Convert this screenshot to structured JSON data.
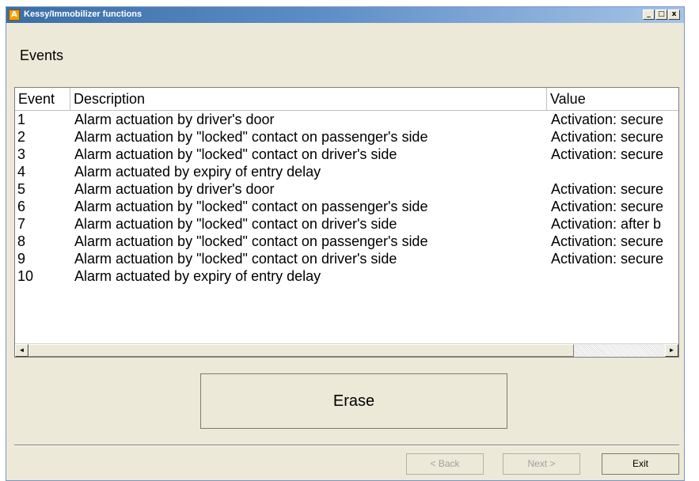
{
  "window": {
    "title": "Kessy/Immobilizer functions",
    "app_icon_letter": "A",
    "title_gradient": [
      "#3a6ea5",
      "#a6c4e6"
    ],
    "controls": {
      "minimize": "_",
      "maximize": "□",
      "close": "x"
    }
  },
  "page": {
    "heading": "Events"
  },
  "events_list": {
    "columns": [
      "Event",
      "Description",
      "Value"
    ],
    "rows": [
      {
        "event": "1",
        "description": "Alarm actuation by driver's door",
        "value": "Activation: secure"
      },
      {
        "event": "2",
        "description": "Alarm actuation by \"locked\" contact on passenger's side",
        "value": "Activation: secure"
      },
      {
        "event": "3",
        "description": "Alarm actuation by \"locked\" contact on driver's side",
        "value": "Activation: secure"
      },
      {
        "event": "4",
        "description": "Alarm actuated by expiry of entry delay",
        "value": ""
      },
      {
        "event": "5",
        "description": "Alarm actuation by driver's door",
        "value": "Activation: secure"
      },
      {
        "event": "6",
        "description": "Alarm actuation by \"locked\" contact on passenger's side",
        "value": "Activation: secure"
      },
      {
        "event": "7",
        "description": "Alarm actuation by \"locked\" contact on driver's side",
        "value": "Activation: after b"
      },
      {
        "event": "8",
        "description": "Alarm actuation by \"locked\" contact on passenger's side",
        "value": "Activation: secure"
      },
      {
        "event": "9",
        "description": "Alarm actuation by \"locked\" contact on driver's side",
        "value": "Activation: secure"
      },
      {
        "event": "10",
        "description": "Alarm actuated by expiry of entry delay",
        "value": ""
      }
    ],
    "scroll_left_glyph": "◄",
    "scroll_right_glyph": "►"
  },
  "actions": {
    "erase_label": "Erase"
  },
  "navigation": {
    "back_label": "< Back",
    "next_label": "Next >",
    "exit_label": "Exit"
  }
}
